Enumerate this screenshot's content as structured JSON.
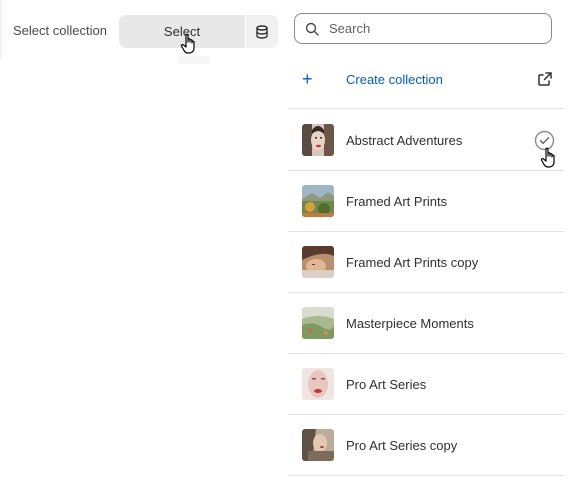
{
  "field": {
    "label": "Select collection",
    "button_label": "Select",
    "db_icon": "database-icon"
  },
  "search": {
    "placeholder": "Search",
    "value": ""
  },
  "create": {
    "label": "Create collection",
    "plus_icon": "+",
    "external_icon": "external-link-icon"
  },
  "collections": [
    {
      "label": "Abstract Adventures",
      "selected": true
    },
    {
      "label": "Framed Art Prints",
      "selected": false
    },
    {
      "label": "Framed Art Prints copy",
      "selected": false
    },
    {
      "label": "Masterpiece Moments",
      "selected": false
    },
    {
      "label": "Pro Art Series",
      "selected": false
    },
    {
      "label": "Pro Art Series copy",
      "selected": false
    }
  ],
  "colors": {
    "accent": "#005bd3",
    "button_bg": "#e8e8e8",
    "divider": "#e3e3e3"
  }
}
